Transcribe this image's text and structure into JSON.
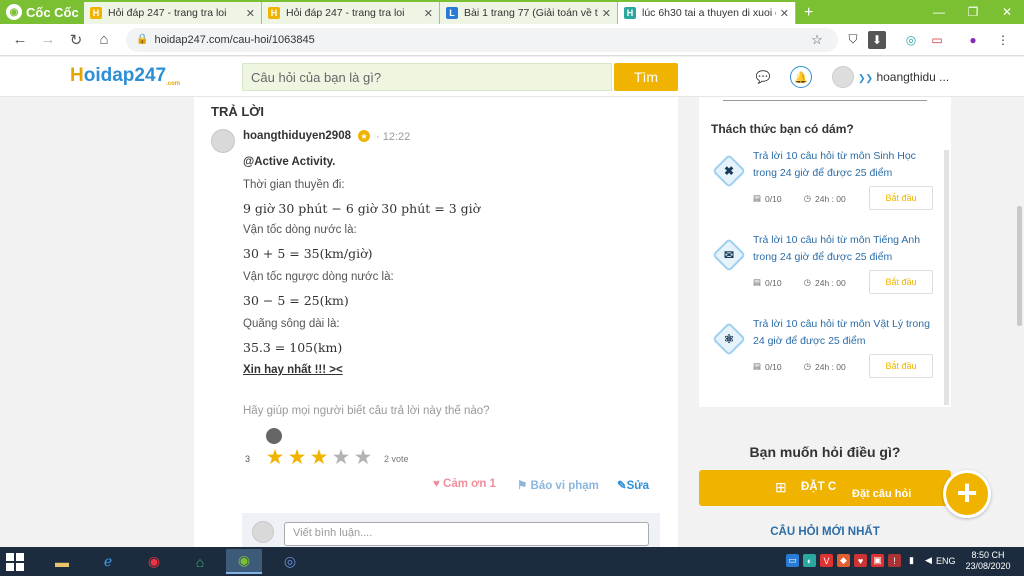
{
  "browser": {
    "brand": "Cốc Cốc",
    "tabs": [
      {
        "title": "Hỏi đáp 247 - trang tra loi",
        "favicon": "H"
      },
      {
        "title": "Hỏi đáp 247 - trang tra loi",
        "favicon": "H"
      },
      {
        "title": "Bài 1 trang 77 (Giải toán về tỉ s",
        "favicon": "L"
      },
      {
        "title": "lúc 6h30 tai a thuyen di xuoi dò",
        "favicon": "H"
      }
    ],
    "url": "hoidap247.com/cau-hoi/1063845"
  },
  "site": {
    "logo_h": "H",
    "logo_rest": "oidap247",
    "logo_sub": ".com",
    "search_placeholder": "Câu hỏi của bạn là gì?",
    "search_button": "Tìm",
    "username": "hoangthidu ..."
  },
  "answer": {
    "section_title": "TRẢ LỜI",
    "author": "hoangthiduyen2908",
    "time": "12:22",
    "lines": [
      "@Active Activity.",
      "Thời gian thuyền đi:",
      "9 giờ 30 phút − 6 giờ 30 phút = 3 giờ",
      "Vận tốc dòng nước là:",
      "30 + 5 = 35(km/giờ)",
      "Vận tốc ngược dòng nước là:",
      "30 − 5 = 25(km)",
      "Quãng sông dài là:",
      "35.3 = 105(km)",
      "Xin hay nhất !!! ><"
    ],
    "help_text": "Hãy giúp mọi người biết câu trả lời này thế nào?",
    "rating": {
      "score": "3",
      "stars": 3,
      "max": 5,
      "votes": "2 vote"
    },
    "thanks": "Cảm ơn 1",
    "report": "Báo vi phạm",
    "edit": "Sửa",
    "comment_placeholder": "Viết bình luận...."
  },
  "sidebar": {
    "challenge_title": "Thách thức bạn có dám?",
    "challenges": [
      {
        "text": "Trả lời 10 câu hỏi  từ môn Sinh Học trong 24 giờ để được 25 điểm",
        "progress": "0/10",
        "time": "24h : 00",
        "button": "Bắt đầu",
        "icon": "dna-icon"
      },
      {
        "text": "Trả lời 10 câu hỏi  từ môn Tiếng Anh trong 24 giờ để được 25 điểm",
        "progress": "0/10",
        "time": "24h : 00",
        "button": "Bắt đầu",
        "icon": "mail-icon"
      },
      {
        "text": "Trả lời 10 câu hỏi  từ môn Vật Lý trong 24 giờ để được 25 điểm",
        "progress": "0/10",
        "time": "24h : 00",
        "button": "Bắt đầu",
        "icon": "atom-icon"
      }
    ],
    "ask_title": "Bạn muốn hỏi điều gì?",
    "ask_button": "ĐẶT C",
    "ask_fab_label": "Đặt câu hỏi",
    "new_questions": "CÂU HỎI MỚI NHẤT"
  },
  "taskbar": {
    "lang": "ENG",
    "time": "8:50 CH",
    "date": "23/08/2020"
  },
  "colors": {
    "accent": "#f0b400",
    "brand_blue": "#2c8fd6",
    "browser_green": "#7bbf33"
  }
}
